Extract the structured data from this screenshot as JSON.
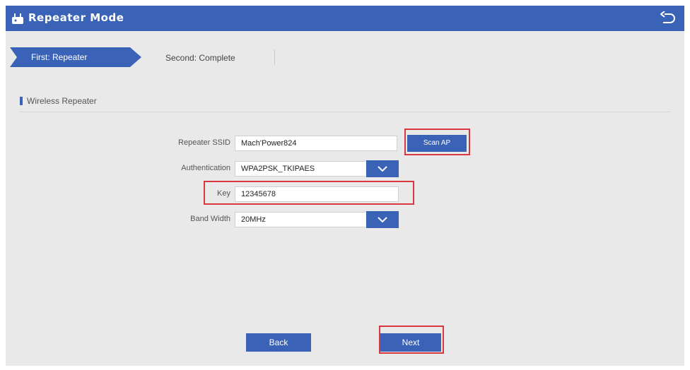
{
  "window": {
    "title": "Repeater Mode"
  },
  "steps": [
    {
      "label": "First: Repeater"
    },
    {
      "label": "Second: Complete"
    }
  ],
  "section": {
    "title": "Wireless Repeater"
  },
  "form": {
    "ssid": {
      "label": "Repeater SSID",
      "value": "Mach'Power824"
    },
    "scan_button": "Scan AP",
    "auth": {
      "label": "Authentication",
      "value": "WPA2PSK_TKIPAES"
    },
    "key": {
      "label": "Key",
      "value": "12345678"
    },
    "bandwidth": {
      "label": "Band Width",
      "value": "20MHz"
    }
  },
  "actions": {
    "back": "Back",
    "next": "Next"
  },
  "colors": {
    "accent": "#3a63b8",
    "highlight": "#d9363e",
    "background": "#e9e9e9"
  },
  "icons": {
    "app": "router-icon",
    "return": "return-arrow-icon",
    "dropdown": "chevron-down-icon"
  }
}
